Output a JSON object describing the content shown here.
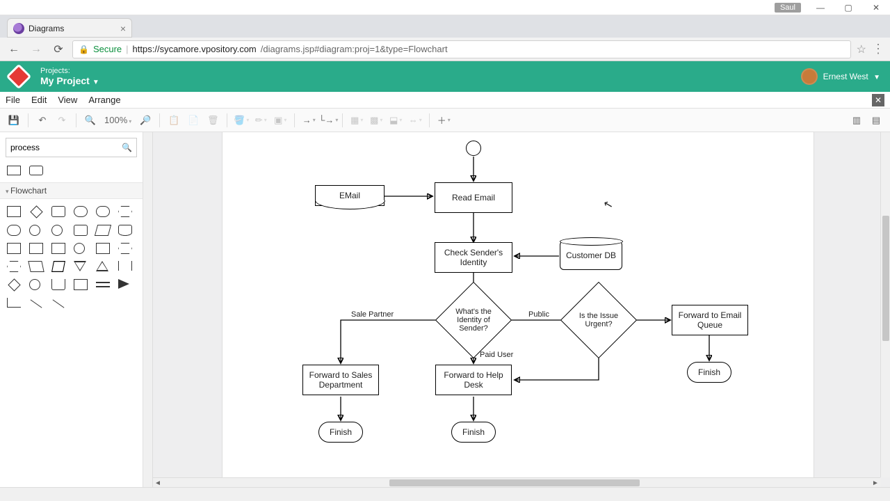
{
  "window": {
    "user_tag": "Saul"
  },
  "browser": {
    "tab_title": "Diagrams",
    "secure_label": "Secure",
    "url_host": "https://sycamore.vpository.com",
    "url_path": "/diagrams.jsp#diagram:proj=1&type=Flowchart"
  },
  "header": {
    "projects_label": "Projects:",
    "project_name": "My Project",
    "user_name": "Ernest West"
  },
  "menu": {
    "file": "File",
    "edit": "Edit",
    "view": "View",
    "arrange": "Arrange"
  },
  "toolbar": {
    "zoom": "100%"
  },
  "sidebar": {
    "search_value": "process",
    "category": "Flowchart"
  },
  "flow": {
    "nodes": {
      "email_doc": "EMail",
      "read_email": "Read Email",
      "check_sender": "Check Sender's Identity",
      "customer_db": "Customer DB",
      "identity_decision": "What's the Identity of Sender?",
      "urgent_decision": "Is the Issue Urgent?",
      "forward_sales": "Forward to Sales Department",
      "forward_helpdesk": "Forward to Help Desk",
      "forward_queue": "Forward to Email Queue",
      "finish1": "Finish",
      "finish2": "Finish",
      "finish3": "Finish"
    },
    "edge_labels": {
      "sale_partner": "Sale Partner",
      "public": "Public",
      "paid_user": "Paid User"
    }
  }
}
